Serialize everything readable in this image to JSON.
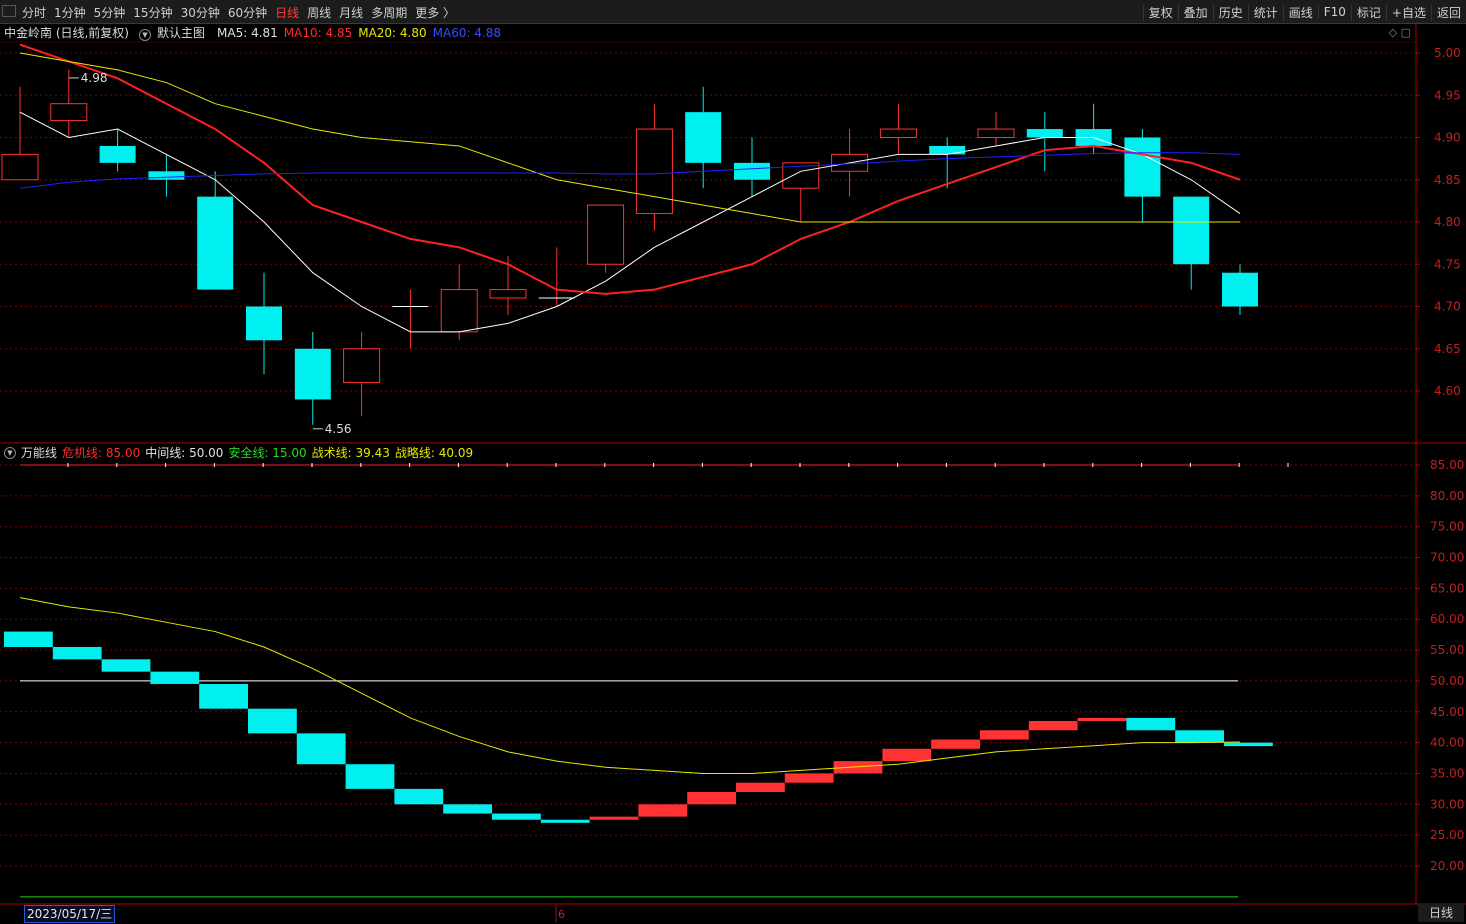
{
  "toolbar": {
    "periods": [
      "分时",
      "1分钟",
      "5分钟",
      "15分钟",
      "30分钟",
      "60分钟",
      "日线",
      "周线",
      "月线",
      "多周期",
      "更多 〉"
    ],
    "active_period": "日线",
    "tools": [
      "复权",
      "叠加",
      "历史",
      "统计",
      "画线",
      "F10",
      "标记",
      "+自选",
      "返回"
    ]
  },
  "header": {
    "title": "中金岭南 (日线,前复权)",
    "main_chart_label": "默认主图",
    "ma5": "MA5: 4.81",
    "ma10": "MA10: 4.85",
    "ma20": "MA20: 4.80",
    "ma60": "MA60: 4.88"
  },
  "indicator": {
    "name": "万能线",
    "danger": "危机线: 85.00",
    "middle": "中间线: 50.00",
    "safe": "安全线: 15.00",
    "tactic": "战术线: 39.43",
    "strategy": "战略线: 40.09"
  },
  "footer": {
    "date_label": "2023/05/17/三",
    "month_marker": "6",
    "period_button": "日线"
  },
  "colors": {
    "up": "#ff3333",
    "down": "#00f0f0",
    "ma5": "#ffffff",
    "ma10": "#ff2020",
    "ma20": "#e8e800",
    "ma60": "#2020ff",
    "grid": "#7a0000"
  },
  "chart_data": [
    {
      "type": "candlestick",
      "ylim": [
        4.55,
        5.02
      ],
      "yticks": [
        "5.00",
        "4.95",
        "4.90",
        "4.85",
        "4.80",
        "4.75",
        "4.70",
        "4.65",
        "4.60"
      ],
      "annotations": [
        {
          "text": "4.98",
          "index": 1,
          "value": 4.98
        },
        {
          "text": "4.56",
          "index": 6,
          "value": 4.56
        }
      ],
      "candles": [
        {
          "o": 4.85,
          "h": 4.96,
          "l": 4.86,
          "c": 4.88
        },
        {
          "o": 4.92,
          "h": 4.98,
          "l": 4.9,
          "c": 4.94
        },
        {
          "o": 4.89,
          "h": 4.91,
          "l": 4.86,
          "c": 4.87
        },
        {
          "o": 4.86,
          "h": 4.88,
          "l": 4.83,
          "c": 4.85
        },
        {
          "o": 4.83,
          "h": 4.86,
          "l": 4.72,
          "c": 4.72
        },
        {
          "o": 4.7,
          "h": 4.74,
          "l": 4.62,
          "c": 4.66
        },
        {
          "o": 4.65,
          "h": 4.67,
          "l": 4.56,
          "c": 4.59
        },
        {
          "o": 4.61,
          "h": 4.67,
          "l": 4.57,
          "c": 4.65
        },
        {
          "o": 4.7,
          "h": 4.72,
          "l": 4.65,
          "c": 4.7
        },
        {
          "o": 4.67,
          "h": 4.75,
          "l": 4.66,
          "c": 4.72
        },
        {
          "o": 4.71,
          "h": 4.76,
          "l": 4.69,
          "c": 4.72
        },
        {
          "o": 4.71,
          "h": 4.77,
          "l": 4.7,
          "c": 4.71
        },
        {
          "o": 4.75,
          "h": 4.82,
          "l": 4.74,
          "c": 4.82
        },
        {
          "o": 4.81,
          "h": 4.94,
          "l": 4.79,
          "c": 4.91
        },
        {
          "o": 4.93,
          "h": 4.96,
          "l": 4.84,
          "c": 4.87
        },
        {
          "o": 4.87,
          "h": 4.9,
          "l": 4.83,
          "c": 4.85
        },
        {
          "o": 4.84,
          "h": 4.87,
          "l": 4.8,
          "c": 4.87
        },
        {
          "o": 4.86,
          "h": 4.91,
          "l": 4.83,
          "c": 4.88
        },
        {
          "o": 4.9,
          "h": 4.94,
          "l": 4.88,
          "c": 4.91
        },
        {
          "o": 4.89,
          "h": 4.9,
          "l": 4.84,
          "c": 4.88
        },
        {
          "o": 4.9,
          "h": 4.93,
          "l": 4.89,
          "c": 4.91
        },
        {
          "o": 4.91,
          "h": 4.93,
          "l": 4.86,
          "c": 4.9
        },
        {
          "o": 4.91,
          "h": 4.94,
          "l": 4.88,
          "c": 4.89
        },
        {
          "o": 4.9,
          "h": 4.91,
          "l": 4.8,
          "c": 4.83
        },
        {
          "o": 4.83,
          "h": 4.83,
          "l": 4.72,
          "c": 4.75
        },
        {
          "o": 4.74,
          "h": 4.75,
          "l": 4.69,
          "c": 4.7
        }
      ],
      "series": [
        {
          "name": "MA5",
          "values": [
            4.93,
            4.9,
            4.91,
            4.88,
            4.85,
            4.8,
            4.74,
            4.7,
            4.67,
            4.67,
            4.68,
            4.7,
            4.73,
            4.77,
            4.8,
            4.83,
            4.86,
            4.87,
            4.88,
            4.88,
            4.89,
            4.9,
            4.9,
            4.88,
            4.85,
            4.81
          ]
        },
        {
          "name": "MA10",
          "values": [
            5.01,
            4.99,
            4.97,
            4.94,
            4.91,
            4.87,
            4.82,
            4.8,
            4.78,
            4.77,
            4.75,
            4.72,
            4.715,
            4.72,
            4.735,
            4.75,
            4.78,
            4.8,
            4.825,
            4.845,
            4.865,
            4.885,
            4.89,
            4.88,
            4.87,
            4.85
          ]
        },
        {
          "name": "MA20",
          "values": [
            5.0,
            4.99,
            4.98,
            4.965,
            4.94,
            4.925,
            4.91,
            4.9,
            4.895,
            4.89,
            4.87,
            4.85,
            4.84,
            4.83,
            4.82,
            4.81,
            4.8,
            4.8,
            4.8,
            4.8,
            4.8,
            4.8,
            4.8,
            4.8,
            4.8,
            4.8
          ]
        },
        {
          "name": "MA60",
          "values": [
            4.84,
            4.847,
            4.851,
            4.853,
            4.855,
            4.857,
            4.858,
            4.858,
            4.858,
            4.858,
            4.858,
            4.858,
            4.857,
            4.857,
            4.86,
            4.863,
            4.866,
            4.869,
            4.872,
            4.875,
            4.877,
            4.879,
            4.881,
            4.882,
            4.882,
            4.88
          ]
        }
      ]
    },
    {
      "type": "line",
      "title": "万能线",
      "ylim": [
        15,
        87
      ],
      "yticks": [
        "85.00",
        "80.00",
        "75.00",
        "70.00",
        "65.00",
        "60.00",
        "55.00",
        "50.00",
        "45.00",
        "40.00",
        "35.00",
        "30.00",
        "25.00",
        "20.00"
      ],
      "levels": [
        {
          "name": "危机线",
          "value": 85.0
        },
        {
          "name": "中间线",
          "value": 50.0
        },
        {
          "name": "安全线",
          "value": 15.0
        }
      ],
      "tactic_steps": [
        {
          "from": 58,
          "to": 55.5
        },
        {
          "from": 55.5,
          "to": 53.5
        },
        {
          "from": 53.5,
          "to": 51.5
        },
        {
          "from": 51.5,
          "to": 49.5
        },
        {
          "from": 49.5,
          "to": 45.5
        },
        {
          "from": 45.5,
          "to": 41.5
        },
        {
          "from": 41.5,
          "to": 36.5
        },
        {
          "from": 36.5,
          "to": 32.5
        },
        {
          "from": 32.5,
          "to": 30
        },
        {
          "from": 30,
          "to": 28.5
        },
        {
          "from": 28.5,
          "to": 27.5
        },
        {
          "from": 27.5,
          "to": 27
        },
        {
          "from": 27.5,
          "to": 28
        },
        {
          "from": 28,
          "to": 30
        },
        {
          "from": 30,
          "to": 32
        },
        {
          "from": 32,
          "to": 33.5
        },
        {
          "from": 33.5,
          "to": 35
        },
        {
          "from": 35,
          "to": 37
        },
        {
          "from": 37,
          "to": 39
        },
        {
          "from": 39,
          "to": 40.5
        },
        {
          "from": 40.5,
          "to": 42
        },
        {
          "from": 42,
          "to": 43.5
        },
        {
          "from": 43.5,
          "to": 44
        },
        {
          "from": 44,
          "to": 42
        },
        {
          "from": 42,
          "to": 40
        },
        {
          "from": 40,
          "to": 39.43
        }
      ],
      "tactic_colors": [
        "down",
        "down",
        "down",
        "down",
        "down",
        "down",
        "down",
        "down",
        "down",
        "down",
        "down",
        "down",
        "up",
        "up",
        "up",
        "up",
        "up",
        "up",
        "up",
        "up",
        "up",
        "up",
        "up",
        "down",
        "down",
        "down"
      ],
      "strategy": [
        63.5,
        62,
        61,
        59.5,
        58,
        55.5,
        52,
        48,
        44,
        41,
        38.5,
        37,
        36,
        35.5,
        35,
        35,
        35.5,
        36,
        36.5,
        37.5,
        38.5,
        39,
        39.5,
        40,
        40,
        40.09
      ]
    }
  ]
}
